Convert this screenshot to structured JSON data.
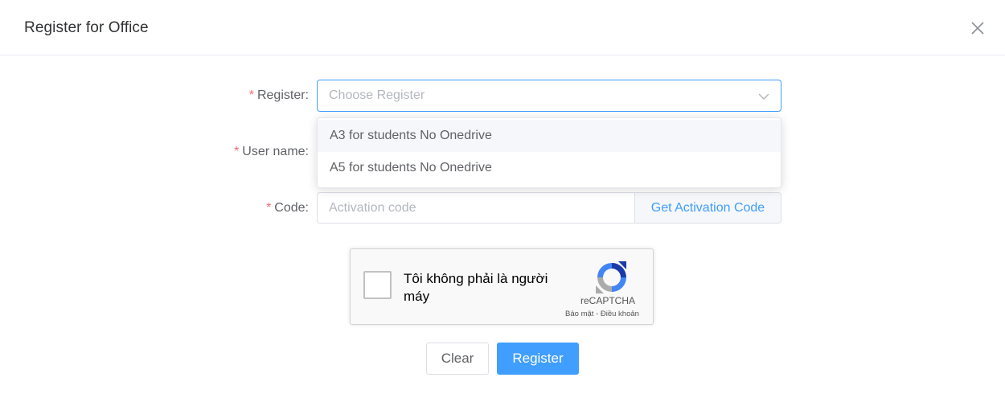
{
  "dialog": {
    "title": "Register for Office",
    "close_icon": "close-icon"
  },
  "form": {
    "register_label": "Register:",
    "register_placeholder": "Choose Register",
    "username_label": "User name:",
    "code_label": "Code:",
    "code_placeholder": "Activation code",
    "get_code_label": "Get Activation Code",
    "required_mark": "*"
  },
  "dropdown": {
    "options": [
      "A3 for students No Onedrive",
      "A5 for students No Onedrive"
    ]
  },
  "captcha": {
    "text": "Tôi không phải là người máy",
    "brand": "reCAPTCHA",
    "links": "Bảo mật - Điều khoản"
  },
  "buttons": {
    "clear": "Clear",
    "register": "Register"
  },
  "colors": {
    "primary": "#409eff",
    "required": "#f56c6c"
  }
}
